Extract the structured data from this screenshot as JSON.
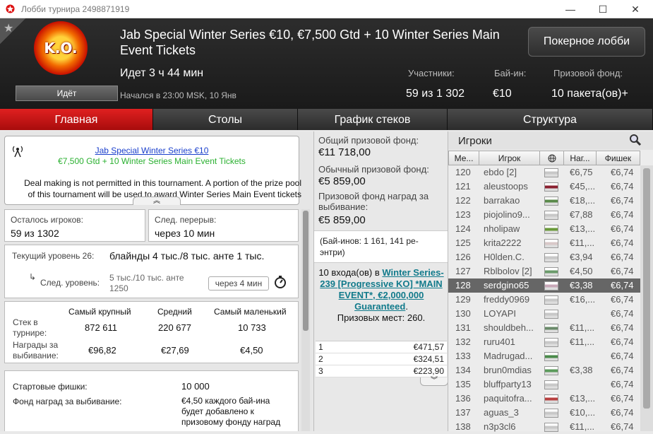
{
  "window": {
    "title": "Лобби турнира 2498871919",
    "minimize": "—",
    "maximize": "☐",
    "close": "✕"
  },
  "header": {
    "badge_text": "K.O.",
    "star": "★",
    "tournament_name": "Jab Special Winter Series €10, €7,500 Gtd + 10 Winter Series Main Event Tickets",
    "status": "Идёт",
    "time_running": "Идет 3 ч 44 мин",
    "started": "Начался в 23:00 MSK, 10 Янв",
    "players_label": "Участники:",
    "players_value": "59 из 1 302",
    "buyin_label": "Бай-ин:",
    "buyin_value": "€10",
    "prize_label": "Призовой фонд:",
    "prize_value": "10 пакета(ов)+",
    "lobby_button": "Покерное лобби"
  },
  "tabs": [
    {
      "label": "Главная",
      "active": true
    },
    {
      "label": "Столы",
      "active": false
    },
    {
      "label": "График стеков",
      "active": false
    },
    {
      "label": "Структура",
      "active": false
    }
  ],
  "notice": {
    "link": "Jab Special Winter Series €10",
    "subtitle": "€7,500 Gtd + 10 Winter Series Main Event Tickets",
    "message": "Deal making is not permitted in this tournament. A portion of the prize pool of this tournament will be used to award Winter Series Main Event tickets",
    "collapse": "︽"
  },
  "stats": {
    "remaining_label": "Осталось игроков:",
    "remaining_value": "59 из 1302",
    "break_label": "След. перерыв:",
    "break_value": "через 10 мин",
    "level_label": "Текущий уровень 26:",
    "level_value": "блайнды 4 тыс./8 тыс. анте 1 тыс.",
    "next_level_label": "След. уровень:",
    "next_level_value": "5 тыс./10 тыс. анте 1250",
    "next_level_time": "через 4 мин",
    "col_largest": "Самый крупный",
    "col_average": "Средний",
    "col_smallest": "Самый маленький",
    "row_stack": "Стек в турнире:",
    "row_bounty": "Награды за выбивание:",
    "stack_largest": "872 611",
    "stack_average": "220 677",
    "stack_smallest": "10 733",
    "bounty_largest": "€96,82",
    "bounty_average": "€27,69",
    "bounty_smallest": "€4,50",
    "start_chips_label": "Стартовые фишки:",
    "start_chips_value": "10 000",
    "bounty_fund_label": "Фонд наград за выбивание:",
    "bounty_fund_value": "€4,50 каждого бай-ина будет добавлено к призовому фонду наград"
  },
  "prizes": {
    "total_label": "Общий призовой фонд:",
    "total_value": "€11 718,00",
    "regular_label": "Обычный призовой фонд:",
    "regular_value": "€5 859,00",
    "bounty_label": "Призовой фонд наград за выбивание:",
    "bounty_value": "€5 859,00",
    "buyins_text": "(Бай-инов: 1 161, 141 ре-энтри)",
    "ticket_pre": "10 входа(ов) в ",
    "ticket_link": "Winter Series-239 [Progressive KO] *MAIN EVENT*, €2,000,000 Guaranteed",
    "ticket_post": ".",
    "paid_places": "Призовых мест: 260.",
    "payouts": [
      {
        "place": "1",
        "amount": "€471,57"
      },
      {
        "place": "2",
        "amount": "€324,51"
      },
      {
        "place": "3",
        "amount": "€223,90"
      }
    ],
    "collapse": "︾"
  },
  "players": {
    "title": "Игроки",
    "columns": [
      "Ме...",
      "Игрок",
      "Наг...",
      "Фишек"
    ],
    "rows": [
      {
        "rank": "120",
        "name": "ebdo [2]",
        "bounty": "€6,75",
        "chips": "€6,74",
        "flag": "#c8c8c8",
        "selected": false
      },
      {
        "rank": "121",
        "name": "aleustoops",
        "bounty": "€45,...",
        "chips": "€6,74",
        "flag": "#8a2030",
        "selected": false
      },
      {
        "rank": "122",
        "name": "barrakao",
        "bounty": "€18,...",
        "chips": "€6,74",
        "flag": "#5a8a4a",
        "selected": false
      },
      {
        "rank": "123",
        "name": "piojolino9...",
        "bounty": "€7,88",
        "chips": "€6,74",
        "flag": "#c8c8c8",
        "selected": false
      },
      {
        "rank": "124",
        "name": "nholipaw",
        "bounty": "€13,...",
        "chips": "€6,74",
        "flag": "#6a9a3a",
        "selected": false
      },
      {
        "rank": "125",
        "name": "krita2222",
        "bounty": "€11,...",
        "chips": "€6,74",
        "flag": "#d8c8c8",
        "selected": false
      },
      {
        "rank": "126",
        "name": "H0lden.C.",
        "bounty": "€3,94",
        "chips": "€6,74",
        "flag": "#c8c8c8",
        "selected": false
      },
      {
        "rank": "127",
        "name": "Rblbolov [2]",
        "bounty": "€4,50",
        "chips": "€6,74",
        "flag": "#6a9a6a",
        "selected": false
      },
      {
        "rank": "128",
        "name": "serdgino65",
        "bounty": "€3,38",
        "chips": "€6,74",
        "flag": "#c8a8b8",
        "selected": true
      },
      {
        "rank": "129",
        "name": "freddy0969",
        "bounty": "€16,...",
        "chips": "€6,74",
        "flag": "#c8c8c8",
        "selected": false
      },
      {
        "rank": "130",
        "name": "LOYAPI",
        "bounty": "",
        "chips": "€6,74",
        "flag": "#c8c8c8",
        "selected": false
      },
      {
        "rank": "131",
        "name": "shouldbeh...",
        "bounty": "€11,...",
        "chips": "€6,74",
        "flag": "#6a8a6a",
        "selected": false
      },
      {
        "rank": "132",
        "name": "ruru401",
        "bounty": "€11,...",
        "chips": "€6,74",
        "flag": "#c8c8c8",
        "selected": false
      },
      {
        "rank": "133",
        "name": "Madrugad...",
        "bounty": "",
        "chips": "€6,74",
        "flag": "#4a8a4a",
        "selected": false
      },
      {
        "rank": "134",
        "name": "brun0mdias",
        "bounty": "€3,38",
        "chips": "€6,74",
        "flag": "#5a9a5a",
        "selected": false
      },
      {
        "rank": "135",
        "name": "bluffparty13",
        "bounty": "",
        "chips": "€6,74",
        "flag": "#c8c8c8",
        "selected": false
      },
      {
        "rank": "136",
        "name": "paquitofra...",
        "bounty": "€13,...",
        "chips": "€6,74",
        "flag": "#b84040",
        "selected": false
      },
      {
        "rank": "137",
        "name": "aguas_3",
        "bounty": "€10,...",
        "chips": "€6,74",
        "flag": "#c8c8c8",
        "selected": false
      },
      {
        "rank": "138",
        "name": "n3p3cl6",
        "bounty": "€11,...",
        "chips": "€6,74",
        "flag": "#c8c8c8",
        "selected": false
      }
    ]
  }
}
